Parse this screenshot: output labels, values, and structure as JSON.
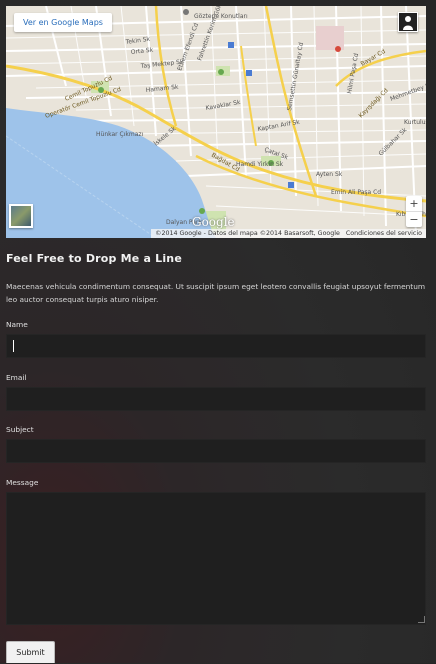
{
  "map": {
    "view_link": "Ver en Google Maps",
    "zoom_in": "+",
    "zoom_out": "−",
    "attribution": "©2014 Google - Datos del mapa ©2014 Basarsoft, Google",
    "terms": "Condiciones del servicio",
    "logo": "Google",
    "street_labels": [
      "Göztepe Konutları",
      "Bayar Cd",
      "Tekin Sk",
      "Orta Sk",
      "Taş Mektep Sk",
      "Fahrettin Kerim Gökay Cd",
      "Ethem Efendi Cd",
      "Hamam Sk",
      "Kavaklar Sk",
      "Semsettin Günaltay Cd",
      "Kaptan Arif Sk",
      "Hilmi Paşa Cd",
      "Kayışdağı Cd",
      "Kurtuluş Cd",
      "Bağdat Cd",
      "Emin Ali Paşa Cd",
      "Ayten Sk",
      "Çatal Sk",
      "Hamdi Yirkin Sk",
      "Kıbrıs Şehitleri Cd",
      "Cemil Topuzlu Cd",
      "Operatör Cemil Topuzlu Cd",
      "İskele Sk",
      "Dalyan Parkı",
      "Hünkar Çıkmazı",
      "Mehmetbey Sk",
      "Gülbahar Sk"
    ]
  },
  "contact": {
    "title": "Feel Free to Drop Me a Line",
    "description": "Maecenas vehicula condimentum consequat. Ut suscipit ipsum eget leotero convallis feugiat upsoyut fermentum leo auctor consequat turpis aturo nisiper.",
    "name_label": "Name",
    "email_label": "Email",
    "subject_label": "Subject",
    "message_label": "Message",
    "name_value": "",
    "email_value": "",
    "subject_value": "",
    "message_value": "",
    "submit_label": "Submit"
  },
  "colors": {
    "background": "#2b2b2b",
    "field_background": "#1f1f1f",
    "map_land": "#e9e4da",
    "map_water": "#9ec3ea",
    "major_road": "#f5d04c"
  }
}
